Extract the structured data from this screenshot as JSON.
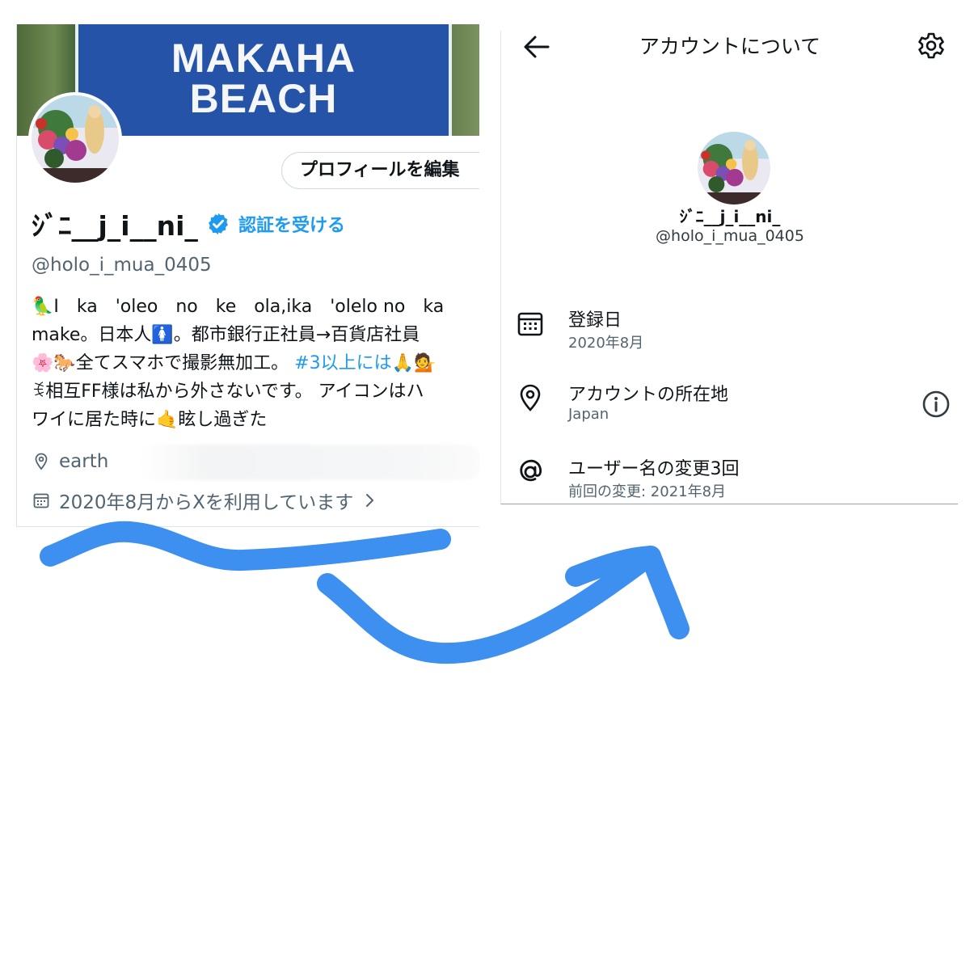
{
  "profile": {
    "banner_sign": [
      "MAKAHA",
      "BEACH"
    ],
    "edit_button": "プロフィールを編集",
    "display_name": "ｼﾞﾆ__j_i__ni_",
    "verify_link": "認証を受ける",
    "handle": "@holo_i_mua_0405",
    "bio": {
      "line1": "🦜I　ka　'oleo　no　ke　ola,ika　'olelo no　ka",
      "line2": "make。日本人🚺。都市銀行正社員→百貨店社員",
      "line3_text": "🌸🐎全てスマホで撮影無加工。",
      "line3_hashtag": "#3以上には🙏💁",
      "line4": "ꉂ相互FF様は私から外さないです。 アイコンはハ",
      "line5": "ワイに居た時に🤙眩し過ぎた"
    },
    "location": "earth",
    "joined": "2020年8月からXを利用しています"
  },
  "about_account": {
    "title": "アカウントについて",
    "display_name": "ｼﾞﾆ__j_i__ni_",
    "handle": "@holo_i_mua_0405",
    "joined_label": "登録日",
    "joined_value": "2020年8月",
    "location_label": "アカウントの所在地",
    "location_value": "Japan",
    "username_label": "ユーザー名の変更3回",
    "username_value": "前回の変更: 2021年8月"
  },
  "colors": {
    "accent": "#1d9bf0",
    "text": "#0f1419",
    "secondary_text": "#536471",
    "arrow": "#3d8ff0",
    "sign_blue": "#2453a8"
  },
  "icons": [
    "verified-badge-icon",
    "location-pin-icon",
    "calendar-icon",
    "chevron-right-icon",
    "back-arrow-icon",
    "gear-icon",
    "info-icon",
    "at-sign-icon"
  ]
}
